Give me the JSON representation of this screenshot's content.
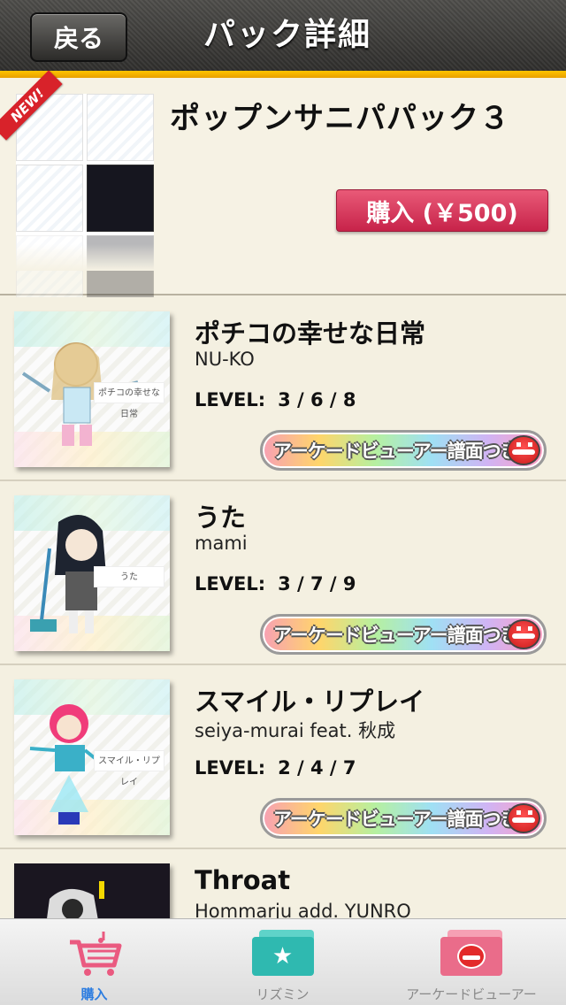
{
  "header": {
    "back_label": "戻る",
    "title": "パック詳細"
  },
  "pack": {
    "badge": "NEW!",
    "name": "ポップンサニパパック３",
    "buy_label": "購入 (￥500)"
  },
  "songs": [
    {
      "title": "ポチコの幸せな日常",
      "artist": "NU-KO",
      "level_label": "LEVEL:",
      "levels": "3 / 6 / 8",
      "art_caption": "ポチコの幸せな日常",
      "badge": "アーケードビューアー譜面つき"
    },
    {
      "title": "うた",
      "artist": "mami",
      "level_label": "LEVEL:",
      "levels": "3 / 7 / 9",
      "art_caption": "うた",
      "badge": "アーケードビューアー譜面つき"
    },
    {
      "title": "スマイル・リプレイ",
      "artist": "seiya-murai feat. 秋成",
      "level_label": "LEVEL:",
      "levels": "2 / 4 / 7",
      "art_caption": "スマイル・リプレイ",
      "badge": "アーケードビューアー譜面つき"
    },
    {
      "title": "Throat",
      "artist": "Hommarju add. YUNRO"
    }
  ],
  "tabs": [
    {
      "label": "購入",
      "icon": "cart-icon",
      "active": true
    },
    {
      "label": "リズミン",
      "icon": "star-folder-icon",
      "active": false
    },
    {
      "label": "アーケードビューアー",
      "icon": "popkun-folder-icon",
      "active": false
    }
  ],
  "colors": {
    "accent_strip": "#ffc400",
    "buy_button": "#d63a5c",
    "active_tab": "#2d7de0"
  }
}
